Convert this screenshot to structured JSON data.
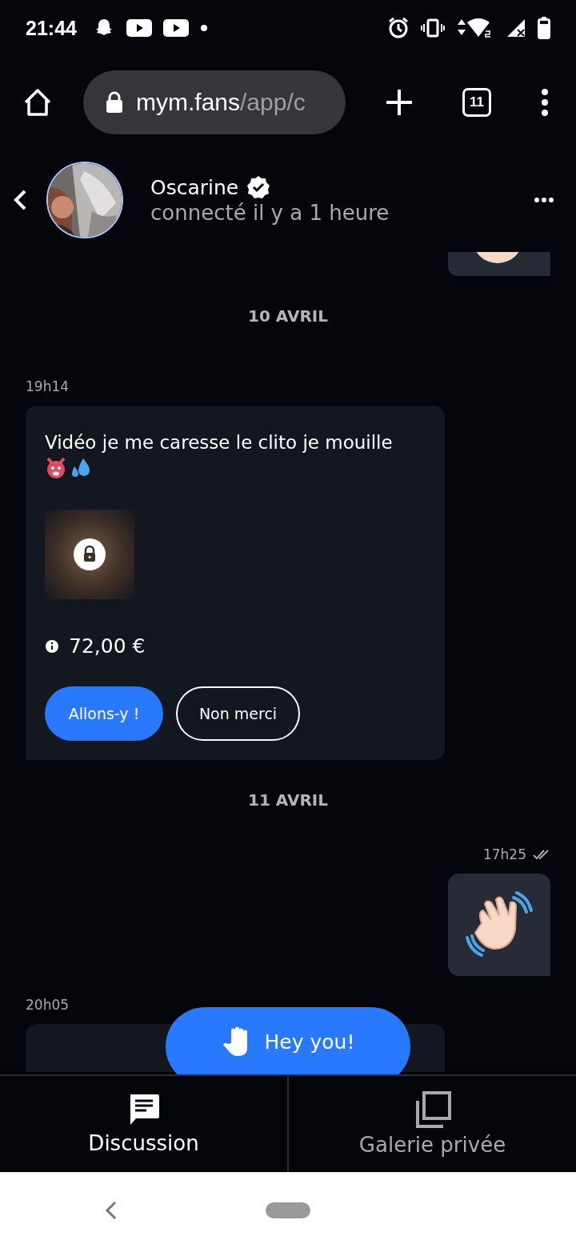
{
  "status_bar": {
    "time": "21:44"
  },
  "browser": {
    "url_host": "mym.fans",
    "url_path": "/app/c",
    "tab_count": "11"
  },
  "chat_header": {
    "name": "Oscarine",
    "verified": true,
    "presence": "connecté il y a 1 heure"
  },
  "messages": [
    {
      "kind": "sticker",
      "cut": true
    },
    {
      "kind": "date",
      "text": "10 AVRIL"
    },
    {
      "kind": "paid",
      "time": "19h14",
      "text": "Vidéo je me caresse le clito je mouille",
      "price": "72,00 €",
      "accept": "Allons-y !",
      "decline": "Non merci"
    },
    {
      "kind": "date",
      "text": "11 AVRIL"
    },
    {
      "kind": "sticker",
      "cut": false,
      "time": "17h25",
      "read": true
    },
    {
      "kind": "text",
      "time": "20h05"
    }
  ],
  "fab": {
    "label": "Hey you!"
  },
  "tabs": [
    {
      "label": "Discussion",
      "selected": true
    },
    {
      "label": "Galerie privée",
      "selected": false
    }
  ]
}
